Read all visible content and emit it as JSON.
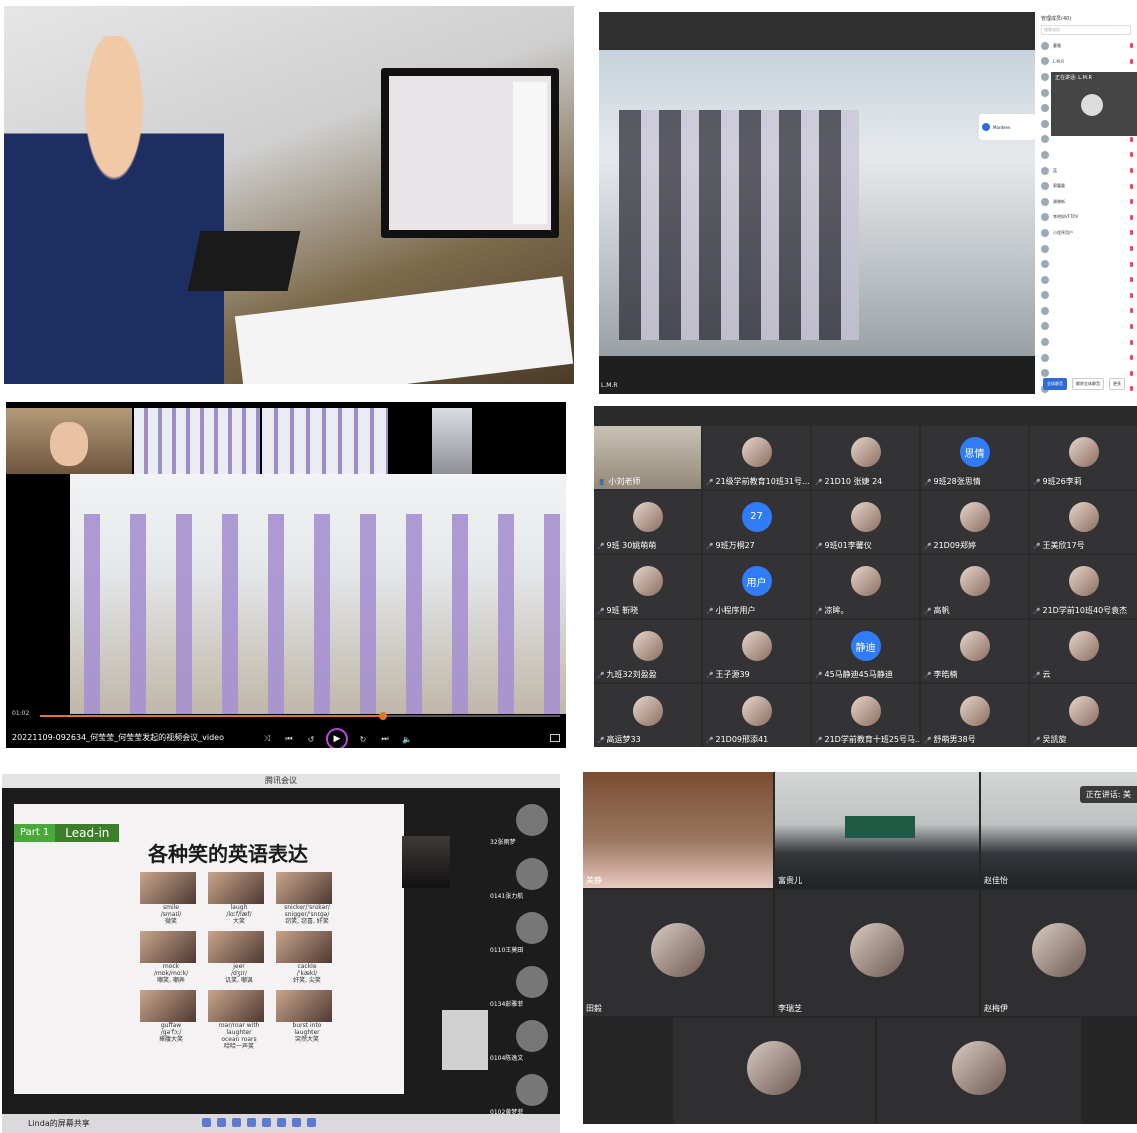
{
  "panel2": {
    "bottom_name": "L.M.R",
    "roster_title": "管理成员(40)",
    "search_placeholder": "搜索成员",
    "participants": [
      "曹雅",
      "L.M.R",
      "",
      "王晓婷",
      "邓丽",
      "Hyun",
      "",
      "",
      "蓝",
      "郭露露",
      "谢晓新",
      "李明如VFTOV",
      "小程序用户",
      "",
      "",
      "",
      "",
      "",
      "",
      "",
      "",
      "",
      ""
    ],
    "float_card": "Mardeen",
    "speaker_label": "正在讲话: L.M.R",
    "buttons": [
      "全体静音",
      "解除全体静音",
      "更多"
    ]
  },
  "panel3": {
    "time": "01:02",
    "title": "20221109-092634_何莹莹_何莹莹发起的视频会议_video",
    "progress": 0.66
  },
  "panel4": {
    "participants": [
      {
        "name": "小刘老师",
        "kind": "video",
        "host": true
      },
      {
        "name": "21级学前教育10班31号...",
        "kind": "photo"
      },
      {
        "name": "21D10 张婕 24",
        "kind": "photo"
      },
      {
        "name": "9班28张思情",
        "kind": "text",
        "avatar_text": "思情"
      },
      {
        "name": "9班26李莉",
        "kind": "photo"
      },
      {
        "name": "9班 30姚萌萌",
        "kind": "photo"
      },
      {
        "name": "9班万桐27",
        "kind": "text",
        "avatar_text": "27"
      },
      {
        "name": "9班01李馨仪",
        "kind": "photo"
      },
      {
        "name": "21D09郑婷",
        "kind": "photo"
      },
      {
        "name": "王美欣17号",
        "kind": "photo"
      },
      {
        "name": "9班 靳晓",
        "kind": "photo"
      },
      {
        "name": "小程序用户",
        "kind": "text",
        "avatar_text": "用户"
      },
      {
        "name": "凉眸。",
        "kind": "photo"
      },
      {
        "name": "高帆",
        "kind": "photo"
      },
      {
        "name": "21D学前10班40号袁杰",
        "kind": "photo"
      },
      {
        "name": "九班32刘盈盈",
        "kind": "photo"
      },
      {
        "name": "王子源39",
        "kind": "photo"
      },
      {
        "name": "45马静迪45马静迪",
        "kind": "text",
        "avatar_text": "静迪"
      },
      {
        "name": "李皓楠",
        "kind": "photo"
      },
      {
        "name": "云",
        "kind": "photo"
      },
      {
        "name": "高运梦33",
        "kind": "photo"
      },
      {
        "name": "21D09邢添41",
        "kind": "photo"
      },
      {
        "name": "21D学前教育十班25号马...",
        "kind": "photo"
      },
      {
        "name": "舒萌男38号",
        "kind": "photo"
      },
      {
        "name": "吴凯旋",
        "kind": "photo"
      }
    ]
  },
  "panel5": {
    "app_title": "腾讯会议",
    "part_label": "Part 1",
    "lead_in": "Lead-in",
    "heading": "各种笑的英语表达",
    "cards": [
      {
        "text": "smile\n/smaɪl/\n微笑"
      },
      {
        "text": "laugh\n/lɑːf/læf/\n大笑"
      },
      {
        "text": "snicker/'snɪkər/\nsnigger/'snɪgə/\n窃笑, 窃喜, 奸笑"
      },
      {
        "text": "mock\n/mɒk/mɑːk/\n嘲笑, 嘲弄"
      },
      {
        "text": "jeer\n/dʒɪr/\n讥笑, 嘲讽"
      },
      {
        "text": "cackle\n/'kækl/\n奸笑, 尖笑"
      },
      {
        "text": "guffaw\n/gə'fɔː/\n捧腹大笑"
      },
      {
        "text": "roar/roar with laughter\nocean roars\n哈哈一声笑"
      },
      {
        "text": "burst into\nlaughter\n突然大笑"
      }
    ],
    "side_participants": [
      "32张雨梦",
      "0141张力航",
      "0110王莫田",
      "0134彭雅菲",
      "0104陈逸文",
      "0102黄梦菲"
    ],
    "share_label": "Linda的屏幕共享"
  },
  "panel6": {
    "speaking": "正在讲话: 美",
    "tiles": [
      {
        "name": "美静"
      },
      {
        "name": "富贵儿"
      },
      {
        "name": "赵佳怡"
      },
      {
        "name": "田毅"
      },
      {
        "name": "李瑞芝"
      },
      {
        "name": "赵梅伊"
      },
      {
        "name": ""
      },
      {
        "name": ""
      }
    ]
  },
  "colors": {
    "accent_orange": "#e0782b",
    "meeting_blue": "#2f7cf6",
    "play_ring": "#b54bd8"
  }
}
